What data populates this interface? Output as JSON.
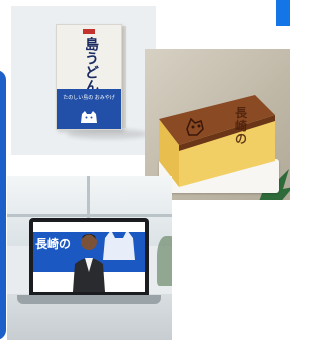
{
  "cards": {
    "udon_box": {
      "title": "島うどん",
      "band_caption": "たのしい島の おみやげ"
    },
    "castella": {
      "brand": "長崎の"
    },
    "laptop": {
      "banner_text": "長崎の"
    }
  },
  "colors": {
    "accent_blue": "#1d5fc9",
    "package_blue": "#2250a8",
    "banner_blue": "#1c58c2"
  }
}
